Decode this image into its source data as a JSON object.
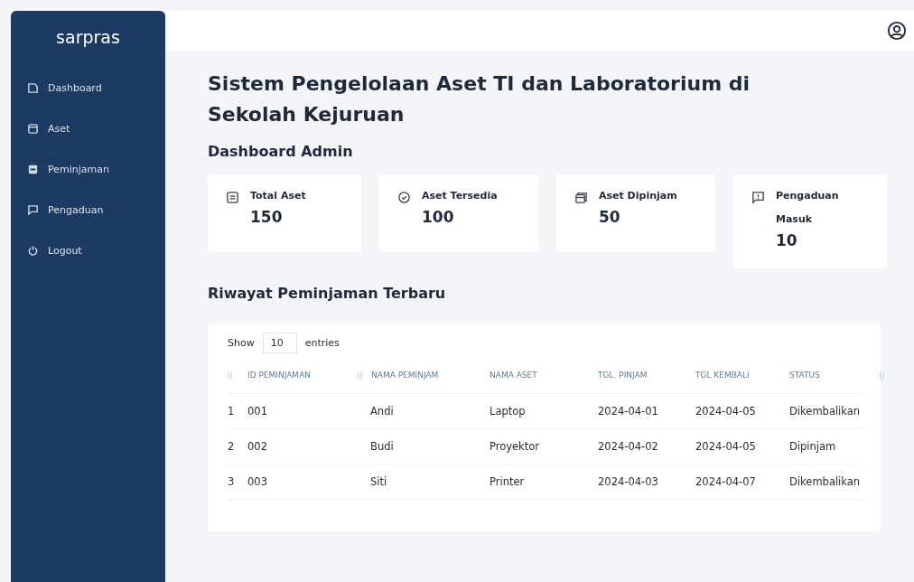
{
  "sidebar": {
    "brand": "sarpras",
    "items": [
      {
        "label": "Dashboard"
      },
      {
        "label": "Aset"
      },
      {
        "label": "Peminjaman"
      },
      {
        "label": "Pengaduan"
      },
      {
        "label": "Logout"
      }
    ]
  },
  "title": "Sistem Pengelolaan Aset TI dan Laboratorium di Sekolah Kejuruan",
  "subtitle": "Dashboard Admin",
  "stats": [
    {
      "label": "Total Aset",
      "value": "150"
    },
    {
      "label": "Aset Tersedia",
      "value": "100"
    },
    {
      "label": "Aset Dipinjam",
      "value": "50"
    },
    {
      "label": "Pengaduan Masuk",
      "value": "10"
    }
  ],
  "history": {
    "title": "Riwayat Peminjaman Terbaru",
    "show_label": "Show",
    "page_size": "10",
    "entries_label": "entries",
    "columns": [
      "",
      "ID PEMINJAMAN",
      "NAMA PEMINJAM",
      "NAMA ASET",
      "TGL. PINJAM",
      "TGL KEMBALI",
      "STATUS"
    ],
    "rows": [
      [
        "1",
        "001",
        "Andi",
        "Laptop",
        "2024-04-01",
        "2024-04-05",
        "Dikembalikan"
      ],
      [
        "2",
        "002",
        "Budi",
        "Proyektor",
        "2024-04-02",
        "2024-04-05",
        "Dipinjam"
      ],
      [
        "3",
        "003",
        "Siti",
        "Printer",
        "2024-04-03",
        "2024-04-07",
        "Dikembalikan"
      ]
    ]
  }
}
